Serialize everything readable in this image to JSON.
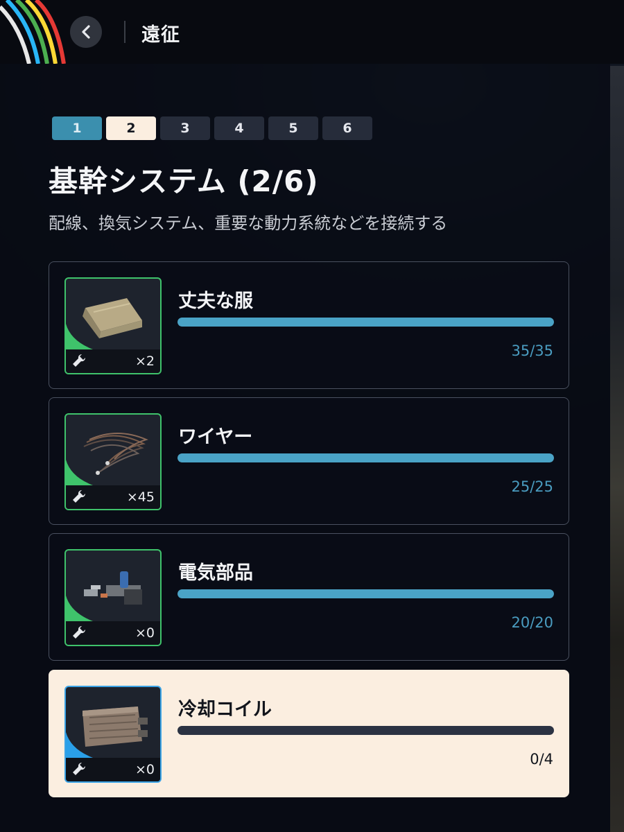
{
  "header": {
    "title": "遠征"
  },
  "steps": [
    {
      "label": "1",
      "state": "done"
    },
    {
      "label": "2",
      "state": "current"
    },
    {
      "label": "3",
      "state": "pending"
    },
    {
      "label": "4",
      "state": "pending"
    },
    {
      "label": "5",
      "state": "pending"
    },
    {
      "label": "6",
      "state": "pending"
    }
  ],
  "section": {
    "title": "基幹システム (2/6)",
    "description": "配線、換気システム、重要な動力系統などを接続する"
  },
  "items": [
    {
      "name": "丈夫な服",
      "count": "×2",
      "progress_text": "35/35",
      "progress": 1.0,
      "icon": "cloth-icon",
      "rarity_color": "#3fc36b"
    },
    {
      "name": "ワイヤー",
      "count": "×45",
      "progress_text": "25/25",
      "progress": 1.0,
      "icon": "wire-icon",
      "rarity_color": "#3fc36b"
    },
    {
      "name": "電気部品",
      "count": "×0",
      "progress_text": "20/20",
      "progress": 1.0,
      "icon": "electrical-parts-icon",
      "rarity_color": "#3fc36b"
    },
    {
      "name": "冷却コイル",
      "count": "×0",
      "progress_text": "0/4",
      "progress": 0.0,
      "icon": "cooling-coil-icon",
      "rarity_color": "#2a9fe8"
    }
  ],
  "colors": {
    "accent": "#4aa3c6",
    "step_done": "#3b8fae",
    "step_current": "#fbeee0",
    "uncommon": "#3fc36b",
    "rare": "#2a9fe8"
  }
}
